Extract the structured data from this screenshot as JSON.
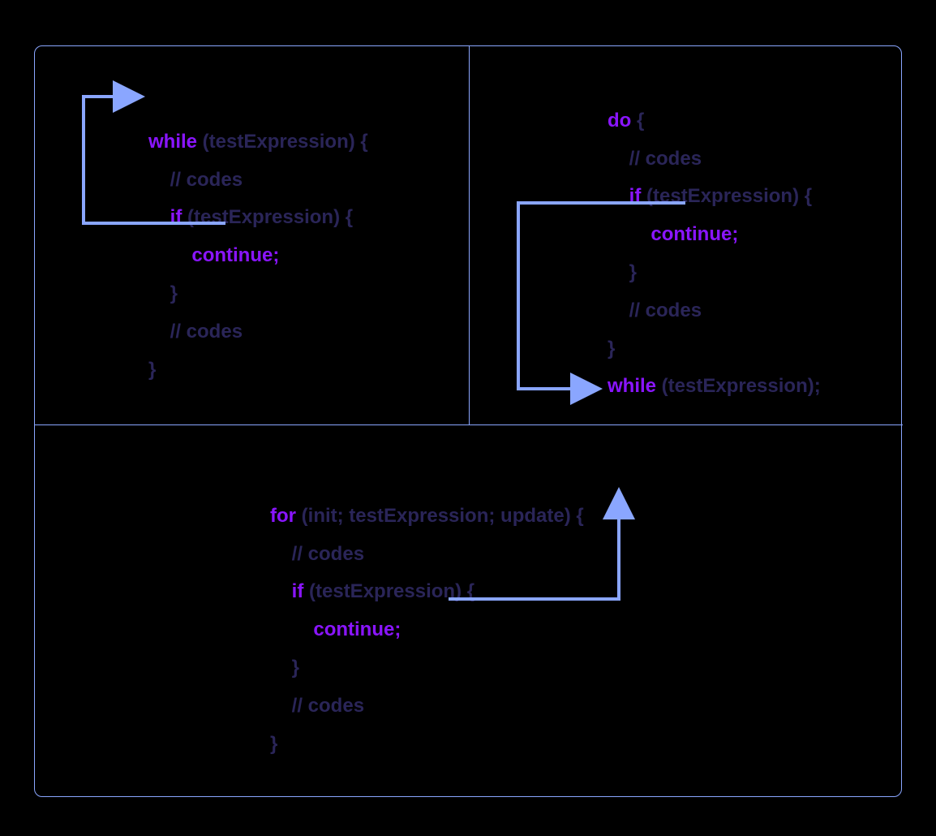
{
  "colors": {
    "border": "#8aa6ff",
    "arrow": "#8aa6ff",
    "keyword": "#8a15ff",
    "text": "#2a2558"
  },
  "panels": {
    "while": {
      "lines": {
        "l0_kw": "while",
        "l0_rest": " (testExpression) {",
        "l1_rest": "    // codes",
        "l2_kw": "    if",
        "l2_rest": " (testExpression) {",
        "l3_kw": "        continue;",
        "l4_rest": "    }",
        "l5_rest": "    // codes",
        "l6_rest": "}"
      }
    },
    "dowhile": {
      "lines": {
        "l0_kw": "do",
        "l0_rest": " {",
        "l1_rest": "    // codes",
        "l2_kw": "    if",
        "l2_rest": " (testExpression) {",
        "l3_kw": "        continue;",
        "l4_rest": "    }",
        "l5_rest": "    // codes",
        "l6_rest": "}",
        "l7_kw": "while",
        "l7_rest": " (testExpression);"
      }
    },
    "for": {
      "lines": {
        "l0_kw": "for",
        "l0_rest": " (init; testExpression; update) {",
        "l1_rest": "    // codes",
        "l2_kw": "    if",
        "l2_rest": " (testExpression) {",
        "l3_kw": "        continue;",
        "l4_rest": "    }",
        "l5_rest": "    // codes",
        "l6_rest": "}"
      }
    }
  }
}
